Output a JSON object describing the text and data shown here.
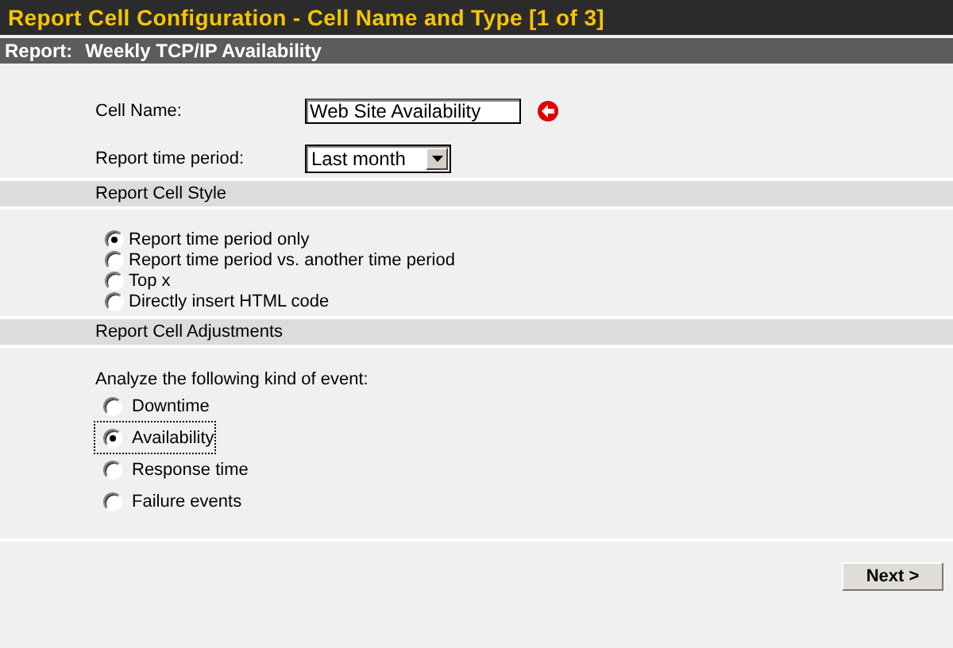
{
  "window": {
    "title": "Report Cell Configuration - Cell Name and Type [1 of 3]"
  },
  "report": {
    "label": "Report:",
    "name": "Weekly TCP/IP Availability"
  },
  "cell_name": {
    "label": "Cell Name:",
    "value": "Web Site Availability"
  },
  "time_period": {
    "label": "Report time period:",
    "value": "Last month"
  },
  "style_section": {
    "title": "Report Cell Style",
    "options": [
      {
        "label": "Report time period only",
        "selected": true
      },
      {
        "label": "Report time period vs. another time period",
        "selected": false
      },
      {
        "label": "Top x",
        "selected": false
      },
      {
        "label": "Directly insert HTML code",
        "selected": false
      }
    ]
  },
  "adjustments_section": {
    "title": "Report Cell Adjustments",
    "prompt": "Analyze the following kind of event:",
    "options": [
      {
        "label": "Downtime",
        "selected": false
      },
      {
        "label": "Availability",
        "selected": true
      },
      {
        "label": "Response time",
        "selected": false
      },
      {
        "label": "Failure events",
        "selected": false
      }
    ]
  },
  "buttons": [
    "Next >"
  ]
}
